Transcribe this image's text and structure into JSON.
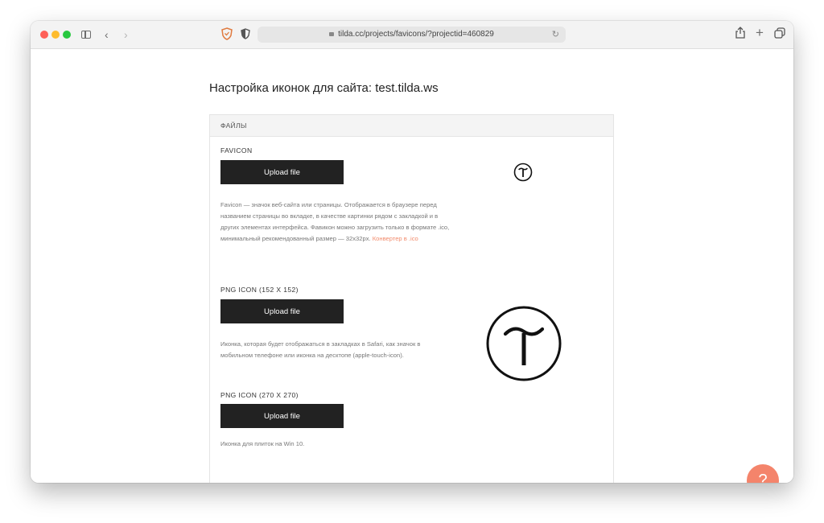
{
  "browser": {
    "url": "tilda.cc/projects/favicons/?projectid=460829"
  },
  "page": {
    "title": "Настройка иконок для сайта: test.tilda.ws"
  },
  "panel": {
    "header": "ФАЙЛЫ",
    "sections": [
      {
        "label": "FAVICON",
        "button": "Upload file",
        "description": "Favicon — значок веб-сайта или страницы. Отображается в браузере перед названием страницы во вкладке, в качестве картинки рядом с закладкой и в других элементах интерфейса. Фавикон можно загрузить только в формате .ico, минимальный рекомендованный размер — 32x32px.",
        "link": "Конвертер в .ico"
      },
      {
        "label": "PNG ICON (152 X 152)",
        "button": "Upload file",
        "description": "Иконка, которая будет отображаться в закладках в Safari, как значок в мобильном телефоне или иконка на десктопе (apple-touch-icon)."
      },
      {
        "label": "PNG ICON (270 X 270)",
        "button": "Upload file",
        "description": "Иконка для плиток на Win 10."
      }
    ]
  },
  "help": {
    "label": "?"
  },
  "icons": {
    "favicon_preview": "tilda-logo-icon",
    "png_preview": "tilda-logo-icon"
  },
  "colors": {
    "button_bg": "#222222",
    "link": "#f28b6c",
    "help_button": "#f4846b"
  }
}
